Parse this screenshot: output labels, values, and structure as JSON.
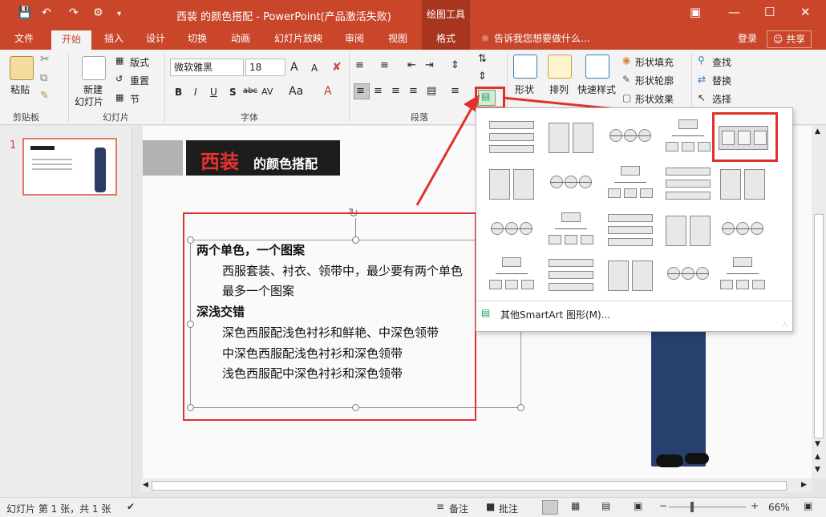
{
  "window": {
    "title": "西装 的颜色搭配 - PowerPoint(产品激活失败)",
    "context_tab": "绘图工具",
    "login": "登录",
    "share": "共享",
    "tell_me": "告诉我您想要做什么..."
  },
  "tabs": [
    "文件",
    "开始",
    "插入",
    "设计",
    "切换",
    "动画",
    "幻灯片放映",
    "审阅",
    "视图",
    "格式"
  ],
  "ribbon": {
    "clipboard": {
      "label": "剪贴板",
      "paste": "粘贴"
    },
    "slides": {
      "label": "幻灯片",
      "new_slide_1": "新建",
      "new_slide_2": "幻灯片",
      "layout": "版式",
      "reset": "重置",
      "section": "节"
    },
    "font": {
      "label": "字体",
      "font_name": "微软雅黑",
      "font_size": "18",
      "bold": "B",
      "italic": "I",
      "underline": "U",
      "shadow": "S",
      "strike": "abc",
      "spacing": "AV",
      "grow": "A",
      "shrink": "A"
    },
    "paragraph": {
      "label": "段落"
    },
    "drawing": {
      "shapes": "形状",
      "arrange": "排列",
      "quick_styles": "快速样式",
      "fill": "形状填充",
      "outline": "形状轮廓",
      "effects": "形状效果"
    },
    "editing": {
      "find": "查找",
      "replace": "替换",
      "select": "选择"
    }
  },
  "smartart_gallery": {
    "more_label": "其他SmartArt 图形(M)..."
  },
  "thumbnail": {
    "number": "1"
  },
  "slide": {
    "title_red": "西装",
    "title_white": "的颜色搭配",
    "lines": [
      {
        "text": "两个单色，一个图案",
        "bold": true,
        "indent": false
      },
      {
        "text": "西服套装、衬衣、领带中，最少要有两个单色",
        "bold": false,
        "indent": true
      },
      {
        "text": "最多一个图案",
        "bold": false,
        "indent": true
      },
      {
        "text": "深浅交错",
        "bold": true,
        "indent": false
      },
      {
        "text": "深色西服配浅色衬衫和鲜艳、中深色领带",
        "bold": false,
        "indent": true
      },
      {
        "text": "中深色西服配浅色衬衫和深色领带",
        "bold": false,
        "indent": true
      },
      {
        "text": "浅色西服配中深色衬衫和深色领带",
        "bold": false,
        "indent": true
      }
    ]
  },
  "status": {
    "slide_info": "幻灯片 第 1 张，共 1 张",
    "notes": "备注",
    "comments": "批注",
    "zoom": "66%",
    "zoom_minus": "−",
    "zoom_plus": "+"
  },
  "colors": {
    "accent": "#c9462b",
    "highlight": "#e0322b"
  },
  "icons": [
    "save-icon",
    "undo-icon",
    "redo-icon",
    "customize-icon",
    "minimize-icon",
    "maximize-icon",
    "close-icon",
    "lightbulb-icon",
    "person-icon"
  ]
}
